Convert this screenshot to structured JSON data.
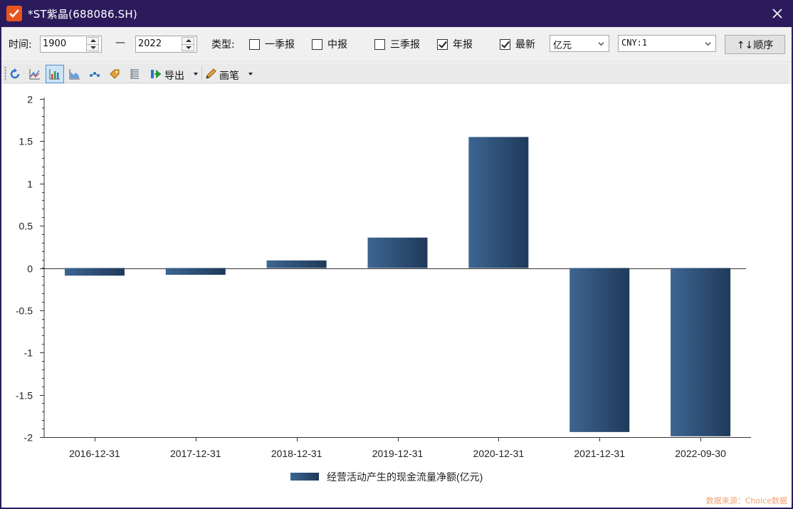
{
  "window": {
    "title": "*ST紫晶(688086.SH)"
  },
  "filters": {
    "time_label": "时间:",
    "start_year": "1900",
    "dash": "—",
    "end_year": "2022",
    "type_label": "类型:",
    "checkboxes": [
      {
        "label": "一季报",
        "checked": false
      },
      {
        "label": "中报",
        "checked": false
      },
      {
        "label": "三季报",
        "checked": false
      },
      {
        "label": "年报",
        "checked": true
      },
      {
        "label": "最新",
        "checked": true
      }
    ],
    "unit_select": "亿元",
    "currency_select": "CNY:1",
    "sort_button": "↑↓顺序"
  },
  "toolbar": {
    "export_label": "导出",
    "pen_label": "画笔"
  },
  "chart_data": {
    "type": "bar",
    "categories": [
      "2016-12-31",
      "2017-12-31",
      "2018-12-31",
      "2019-12-31",
      "2020-12-31",
      "2021-12-31",
      "2022-09-30"
    ],
    "series": [
      {
        "name": "经营活动产生的现金流量净额(亿元)",
        "values": [
          -0.09,
          -0.08,
          0.09,
          0.36,
          1.55,
          -1.94,
          -1.99
        ]
      }
    ],
    "ylim": [
      -2,
      2
    ],
    "yticks": [
      "2",
      "1.5",
      "1",
      "0.5",
      "0",
      "-0.5",
      "-1",
      "-1.5",
      "-2"
    ],
    "legend_position": "bottom-center",
    "bar_color_light": "#3d6591",
    "bar_color_dark": "#1f3a5a"
  },
  "source_note": "数据来源：Choice数据"
}
